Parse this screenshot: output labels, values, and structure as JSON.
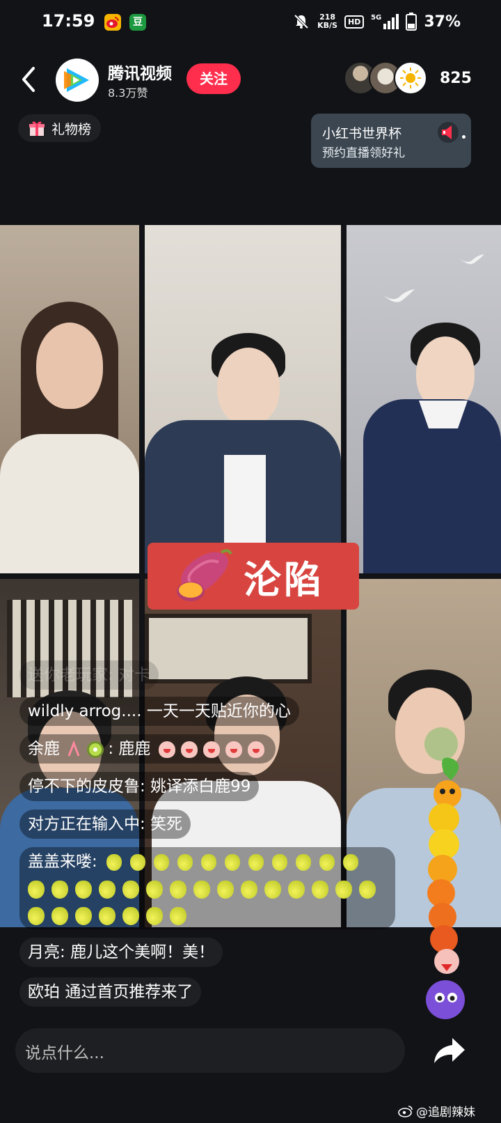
{
  "status_bar": {
    "time": "17:59",
    "apps": [
      "weibo-icon",
      "douban-icon"
    ],
    "douban_glyph": "豆",
    "net_speed_value": "218",
    "net_speed_unit": "KB/S",
    "hd": "HD",
    "network": "5G",
    "battery": "37%"
  },
  "header": {
    "host_name": "腾讯视频",
    "host_likes": "8.3万赞",
    "follow_label": "关注",
    "viewer_count": "825"
  },
  "gift_rank_label": "礼物榜",
  "promo": {
    "title": "小红书世界杯",
    "subtitle": "预约直播领好礼"
  },
  "sticker": {
    "text": "沦陷",
    "icon": "sweet-potato-icon"
  },
  "chat": [
    {
      "user": "送你老玩家",
      "sep": ": ",
      "text": "对卡"
    },
    {
      "user": "wildly arrog....",
      "sep": " ",
      "text": "一天一天贴近你的心"
    },
    {
      "user": "余鹿",
      "sep": ": ",
      "text": "鹿鹿"
    },
    {
      "user": "停不下的皮皮鲁",
      "sep": ": ",
      "text": "姚译添白鹿99"
    },
    {
      "user": "对方正在输入中",
      "sep": ": ",
      "text": "笑死"
    },
    {
      "user": "盖盖来喽",
      "sep": ": ",
      "text": ""
    },
    {
      "user": "月亮",
      "sep": ": ",
      "text": "鹿儿这个美啊！美！"
    },
    {
      "user": "欧珀",
      "sep": " ",
      "text": "通过首页推荐来了"
    }
  ],
  "comment_placeholder": "说点什么...",
  "watermark": "@追剧辣妹",
  "colors": {
    "background": "#121317",
    "follow": "#ff2e4d",
    "sticker": "#d84540",
    "promo_card": "#3b4650"
  }
}
